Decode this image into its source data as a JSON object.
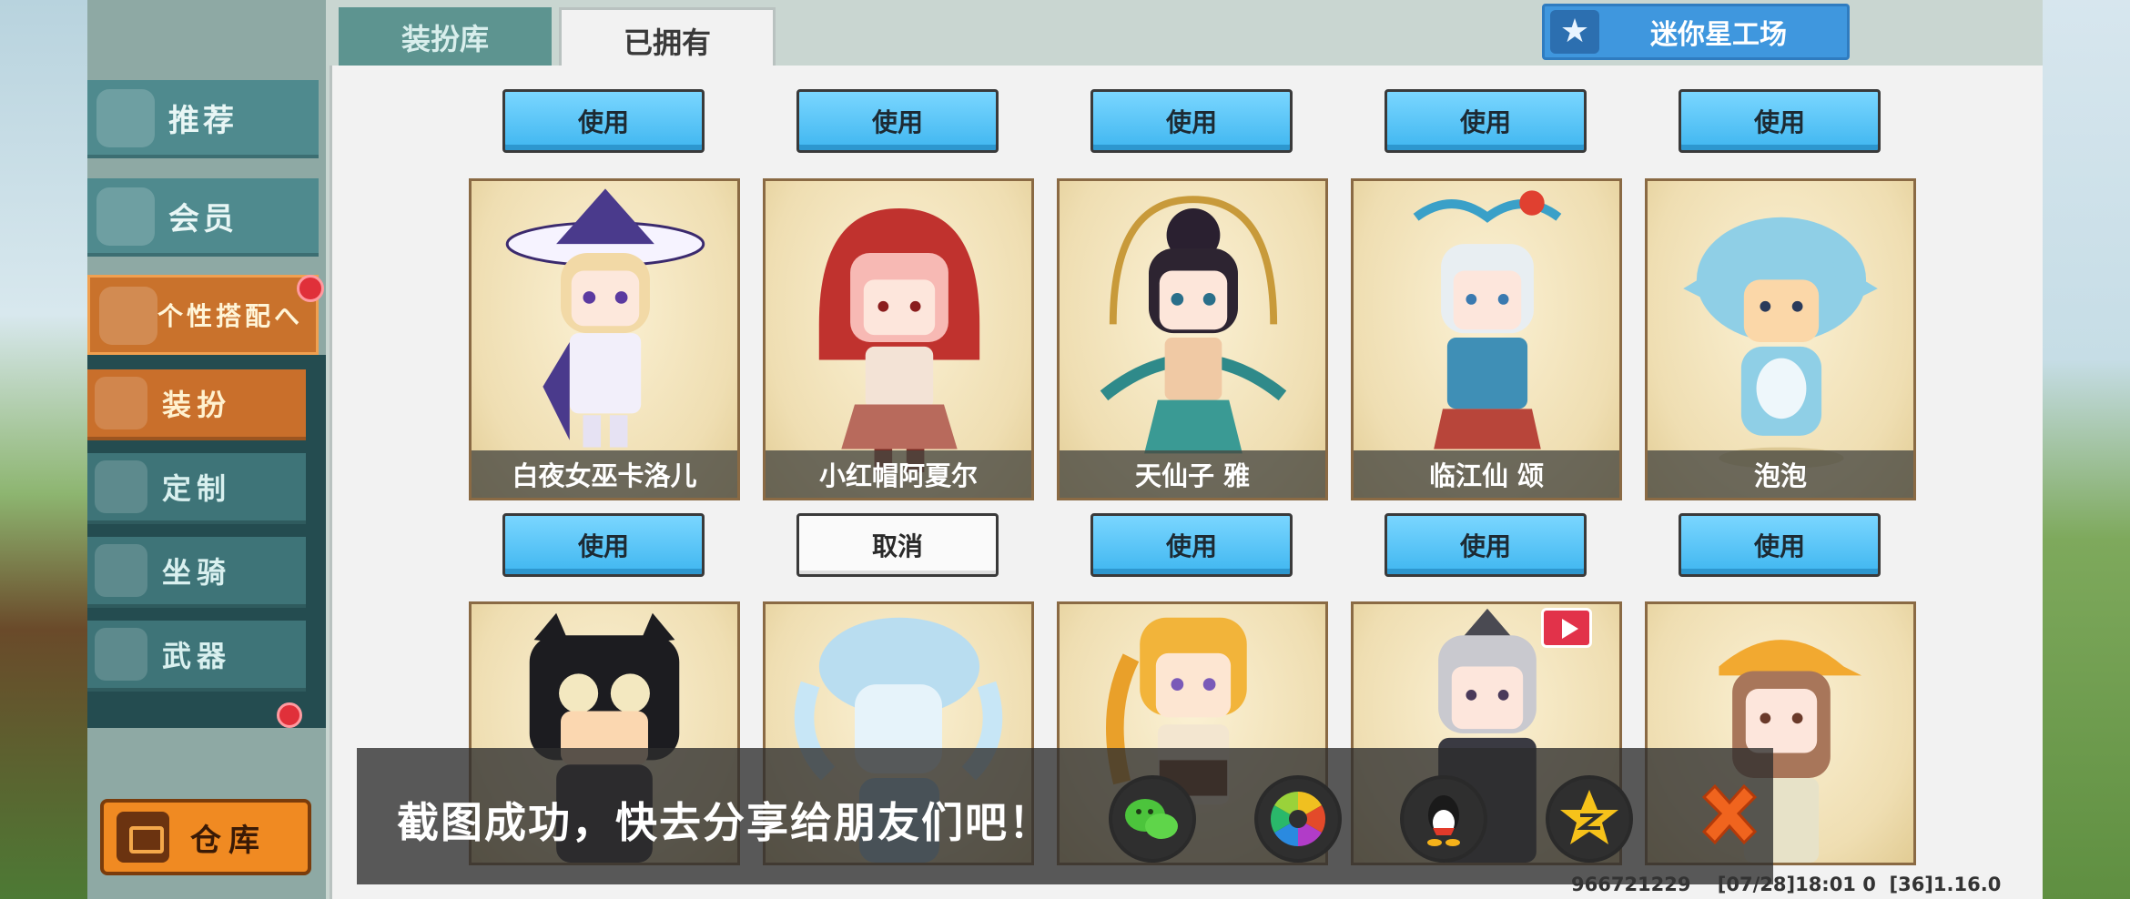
{
  "tabs": {
    "outfit_library": "装扮库",
    "owned": "已拥有"
  },
  "workshop": {
    "label": "迷你星工场",
    "icon": "star-icon"
  },
  "sidebar": {
    "recommend": "推荐",
    "member": "会员",
    "personal_style": "个性搭配へ",
    "sub": {
      "outfit": "装扮",
      "customize": "定制",
      "mount": "坐骑",
      "weapon": "武器"
    },
    "warehouse": "仓库"
  },
  "cards_row1": [
    {
      "action": "使用",
      "name": "白夜女巫卡洛儿"
    },
    {
      "action": "使用",
      "name": "小红帽阿夏尔"
    },
    {
      "action": "使用",
      "name": "天仙子 雅"
    },
    {
      "action": "使用",
      "name": "临江仙 颂"
    },
    {
      "action": "使用",
      "name": "泡泡"
    }
  ],
  "cards_row2": [
    {
      "action": "使用"
    },
    {
      "action": "取消"
    },
    {
      "action": "使用"
    },
    {
      "action": "使用"
    },
    {
      "action": "使用"
    }
  ],
  "toast": {
    "message": "截图成功，快去分享给朋友们吧！",
    "share_targets": [
      "wechat-icon",
      "moments-icon",
      "qq-icon",
      "qzone-icon"
    ],
    "close_icon": "close-icon"
  },
  "footer": {
    "uid": "966721229",
    "timestamp": "[07/28]18:01 0",
    "version": "[36]1.16.0"
  },
  "colors": {
    "accent_blue": "#3fb6f0",
    "accent_orange": "#c96f2b",
    "sidebar_teal": "#4f8a8e"
  }
}
